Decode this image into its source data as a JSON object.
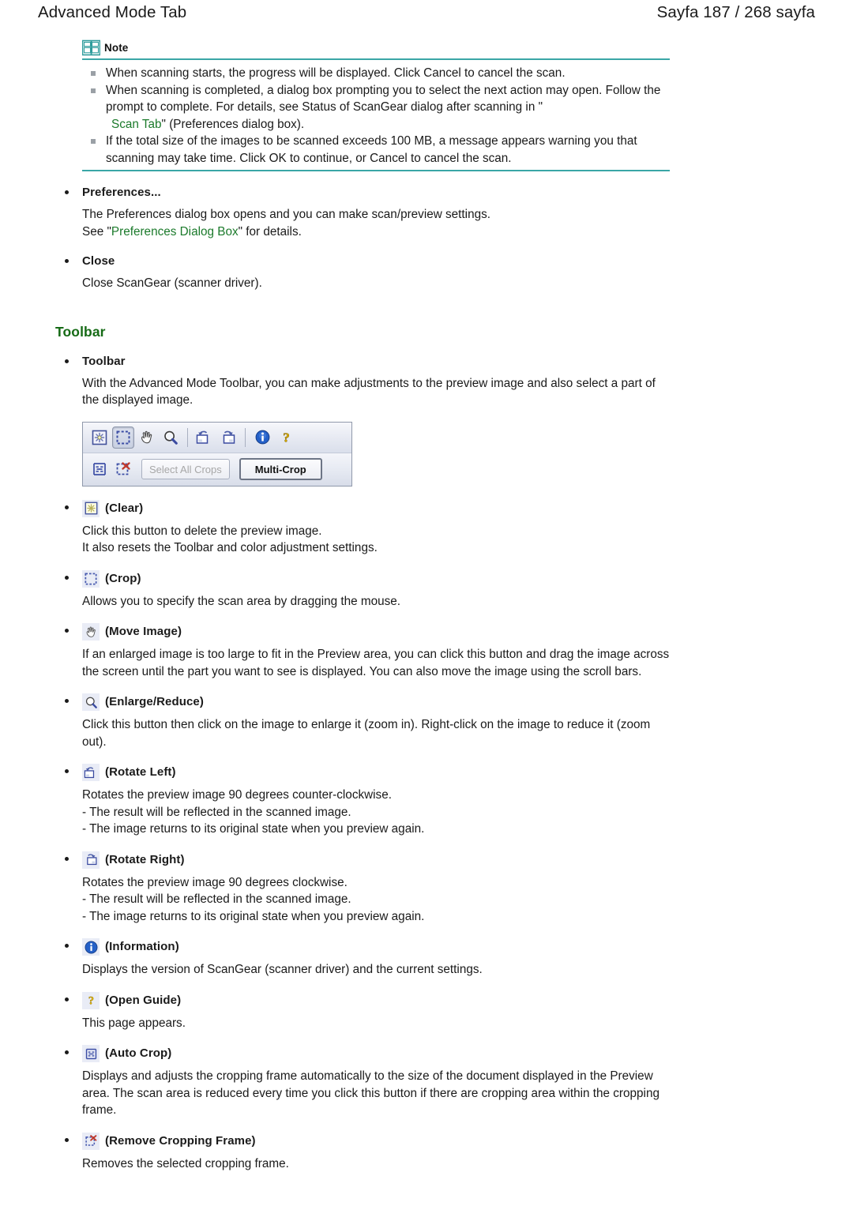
{
  "header": {
    "title": "Advanced Mode Tab",
    "page_indicator": "Sayfa 187 / 268 sayfa"
  },
  "note": {
    "label": "Note",
    "icon": "open-book-icon",
    "rule_color": "#3aa6a6",
    "items": [
      {
        "text": "When scanning starts, the progress will be displayed. Click Cancel to cancel the scan."
      },
      {
        "text": "When scanning is completed, a dialog box prompting you to select the next action may open. Follow the prompt to complete. For details, see Status of ScanGear dialog after scanning in \"",
        "link": "Scan Tab",
        "text_after": "\" (Preferences dialog box)."
      },
      {
        "text": "If the total size of the images to be scanned exceeds 100 MB, a message appears warning you that scanning may take time. Click OK to continue, or Cancel to cancel the scan."
      }
    ]
  },
  "preferences": {
    "bullet_label": "Preferences...",
    "line1": "The Preferences dialog box opens and you can make scan/preview settings.",
    "line2_before": "See \"",
    "line2_link": "Preferences Dialog Box",
    "line2_after": "\" for details."
  },
  "close": {
    "bullet_label": "Close",
    "body": "Close ScanGear (scanner driver)."
  },
  "toolbar_section": {
    "heading": "Toolbar",
    "bullet_label": "Toolbar",
    "body": "With the Advanced Mode Toolbar, you can make adjustments to the preview image and also select a part of the displayed image.",
    "screenshot": {
      "row1_icons": [
        "clear-icon",
        "crop-icon",
        "move-image-icon",
        "enlarge-reduce-icon",
        "rotate-left-icon",
        "rotate-right-icon",
        "information-icon",
        "open-guide-icon"
      ],
      "row2_icons": [
        "auto-crop-icon",
        "remove-cropping-frame-icon"
      ],
      "select_all_crops_label": "Select All Crops",
      "multi_crop_label": "Multi-Crop"
    }
  },
  "tool_entries": [
    {
      "icon": "clear-icon",
      "label": "(Clear)",
      "body": "Click this button to delete the preview image.\nIt also resets the Toolbar and color adjustment settings."
    },
    {
      "icon": "crop-icon",
      "label": "(Crop)",
      "body": "Allows you to specify the scan area by dragging the mouse."
    },
    {
      "icon": "move-image-icon",
      "label": "(Move Image)",
      "body": "If an enlarged image is too large to fit in the Preview area, you can click this button and drag the image across the screen until the part you want to see is displayed. You can also move the image using the scroll bars."
    },
    {
      "icon": "enlarge-reduce-icon",
      "label": "(Enlarge/Reduce)",
      "body": "Click this button then click on the image to enlarge it (zoom in). Right-click on the image to reduce it (zoom out)."
    },
    {
      "icon": "rotate-left-icon",
      "label": "(Rotate Left)",
      "body": "Rotates the preview image 90 degrees counter-clockwise.\n- The result will be reflected in the scanned image.\n- The image returns to its original state when you preview again."
    },
    {
      "icon": "rotate-right-icon",
      "label": "(Rotate Right)",
      "body": "Rotates the preview image 90 degrees clockwise.\n- The result will be reflected in the scanned image.\n- The image returns to its original state when you preview again."
    },
    {
      "icon": "information-icon",
      "label": "(Information)",
      "body": "Displays the version of ScanGear (scanner driver) and the current settings."
    },
    {
      "icon": "open-guide-icon",
      "label": "(Open Guide)",
      "body": "This page appears."
    },
    {
      "icon": "auto-crop-icon",
      "label": "(Auto Crop)",
      "body": "Displays and adjusts the cropping frame automatically to the size of the document displayed in the Preview area. The scan area is reduced every time you click this button if there are cropping area within the cropping frame."
    },
    {
      "icon": "remove-cropping-frame-icon",
      "label": "(Remove Cropping Frame)",
      "body": "Removes the selected cropping frame."
    }
  ]
}
